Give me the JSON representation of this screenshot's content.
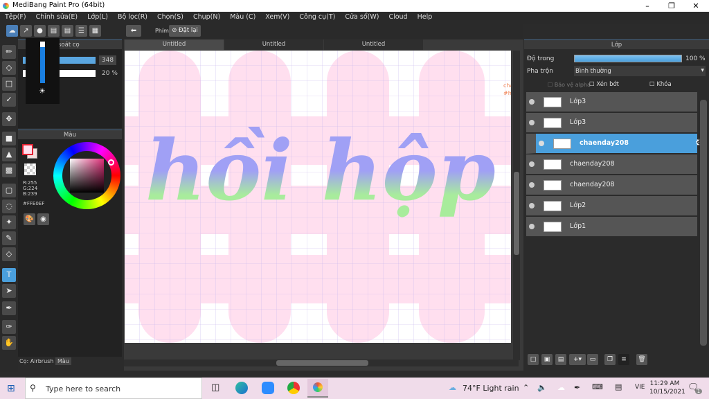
{
  "window": {
    "title": "MediBang Paint Pro (64bit)"
  },
  "menu": [
    "Tệp(F)",
    "Chỉnh sửa(E)",
    "Lớp(L)",
    "Bộ lọc(R)",
    "Chọn(S)",
    "Chụp(N)",
    "Màu (C)",
    "Xem(V)",
    "Công cụ(T)",
    "Cửa sổ(W)",
    "Cloud",
    "Help"
  ],
  "toolbar": {
    "shortcut_label": "Phím",
    "reset_label": "Đặt lại"
  },
  "brush_panel": {
    "title": "soát cọ",
    "size": "348",
    "opacity": "20 %"
  },
  "color_panel": {
    "title": "Màu",
    "r": "R:255",
    "g": "G:224",
    "b": "B:239",
    "hex": "#FFE0EF",
    "primary": "#FFE0EF",
    "secondary": "#f3dcdc"
  },
  "bottom_tabs": [
    "Cọ: Airbrush",
    "Màu"
  ],
  "doc_tabs": [
    "Untitled",
    "Untitled",
    "Untitled"
  ],
  "canvas": {
    "text": "hồi hộp",
    "side_text": [
      "cha",
      "#h"
    ]
  },
  "layers_panel": {
    "title": "Lớp",
    "opacity_label": "Độ trong",
    "opacity_value": "100 %",
    "opacity": 100,
    "blend_label": "Pha trộn",
    "blend_value": "Bình thường",
    "protect_alpha": "Bảo vệ alpha",
    "clip": "Xén bớt",
    "lock": "Khóa",
    "layers": [
      {
        "name": "Lớp3",
        "selected": false
      },
      {
        "name": "Lớp3",
        "selected": false
      },
      {
        "name": "chaenday208",
        "selected": true
      },
      {
        "name": "chaenday208",
        "selected": false
      },
      {
        "name": "chaenday208",
        "selected": false
      },
      {
        "name": "Lớp2",
        "selected": false
      },
      {
        "name": "Lớp1",
        "selected": false
      }
    ]
  },
  "taskbar": {
    "search_placeholder": "Type here to search",
    "weather": "74°F  Light rain",
    "lang": "VIE",
    "time": "11:29 AM",
    "date": "10/15/2021",
    "notif_count": "1"
  },
  "colors": {
    "accent": "#4a9fdc",
    "canvas_bg": "#ffdfef",
    "text_purple": "#a0a0f5",
    "text_green": "#a8ec9c"
  }
}
